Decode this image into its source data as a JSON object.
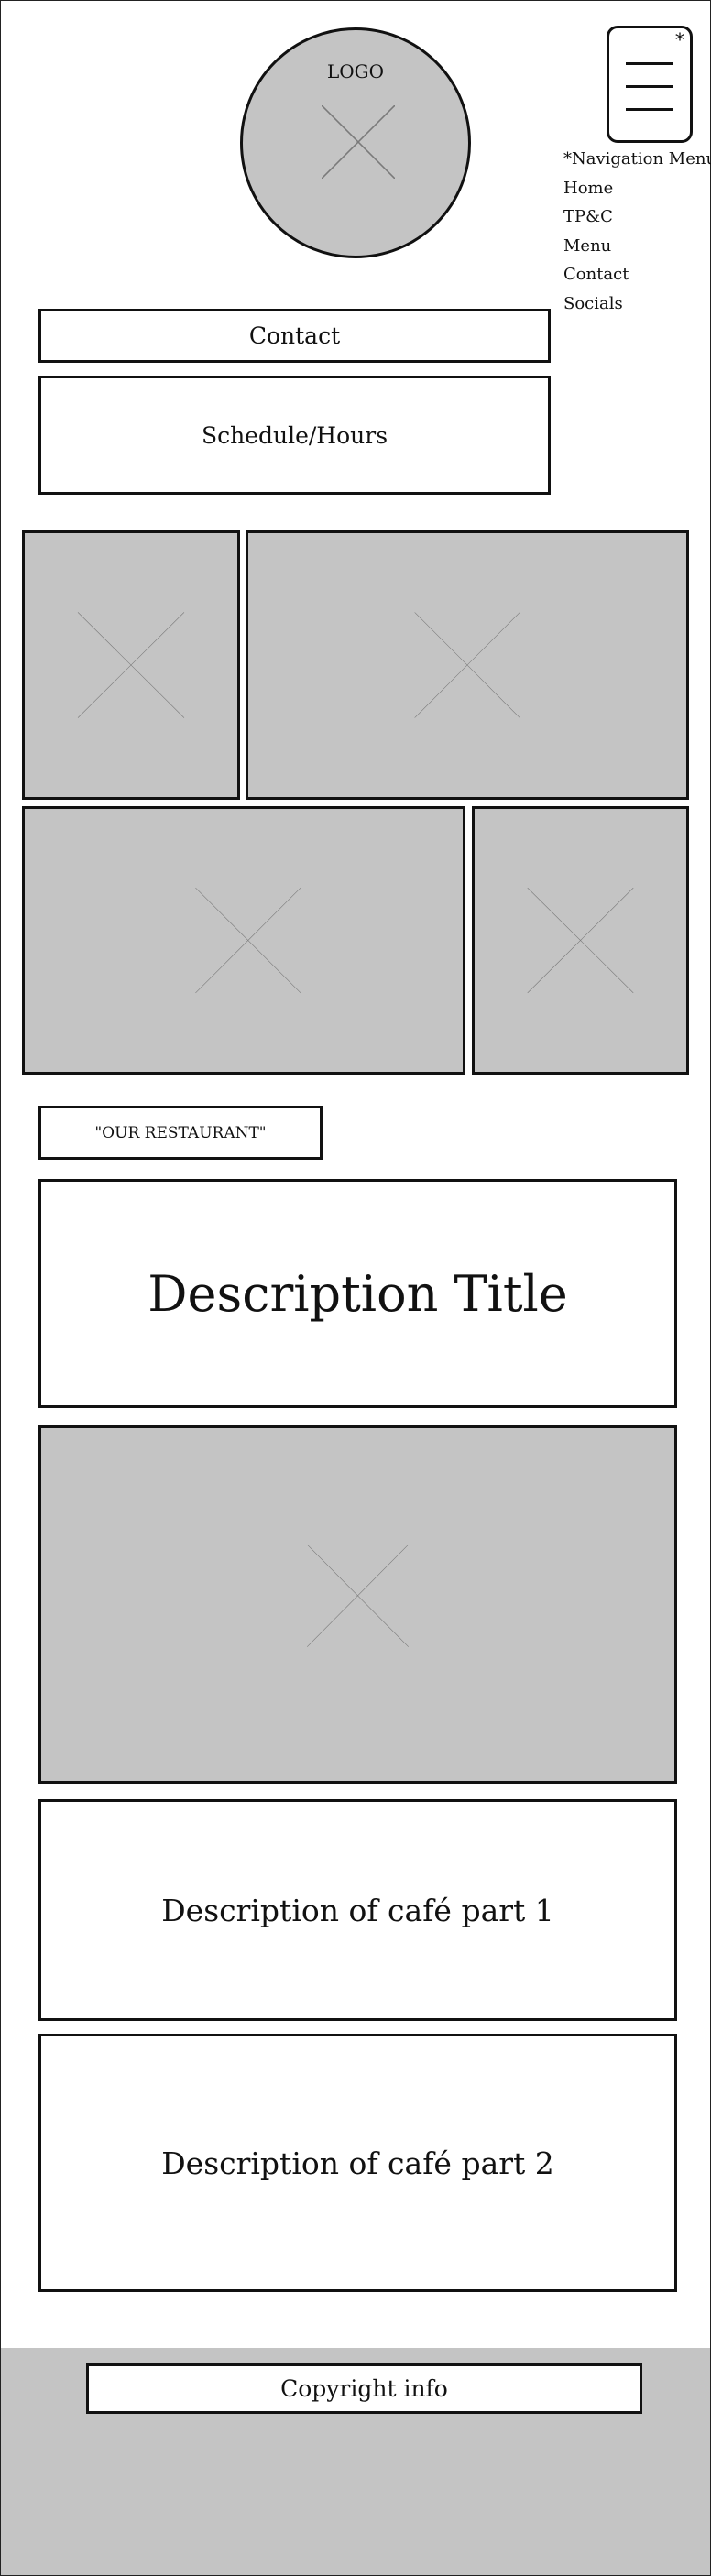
{
  "header": {
    "logo_text": "LOGO",
    "menu_toggle_marker": "*"
  },
  "nav_menu": {
    "heading": "*Navigation Menu:",
    "items": [
      "Home",
      "TP&C",
      "Menu",
      "Contact",
      "Socials"
    ]
  },
  "contact_label": "Contact",
  "hours_label": "Schedule/Hours",
  "our_restaurant_label": "\"OUR RESTAURANT\"",
  "description": {
    "title": "Description Title",
    "part1": "Description of café part 1",
    "part2": "Description of café part 2"
  },
  "footer": {
    "copyright": "Copyright info"
  },
  "colors": {
    "placeholder_fill": "#c4c4c4",
    "border": "#111111",
    "placeholder_cross": "#7a7a7a"
  }
}
